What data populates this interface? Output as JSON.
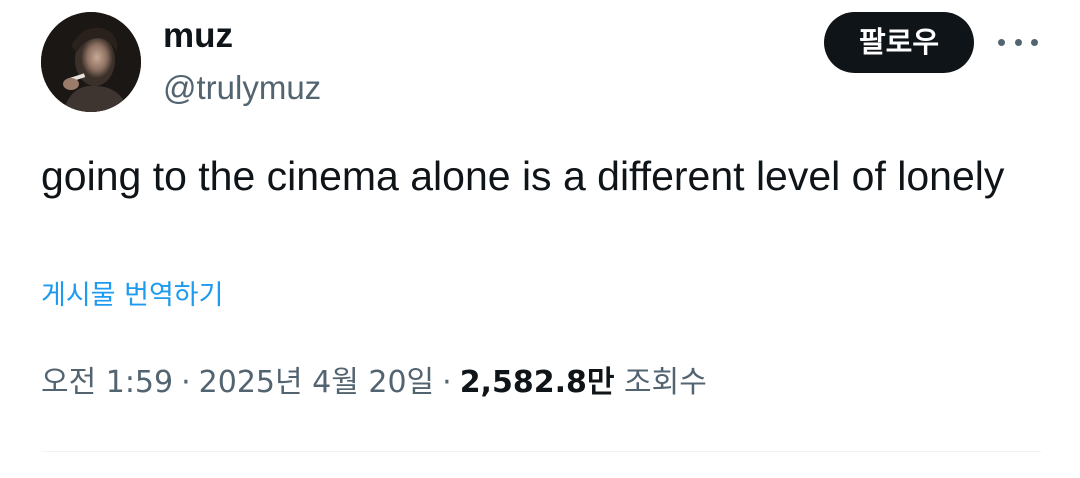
{
  "user": {
    "display_name": "muz",
    "handle": "@trulymuz",
    "avatar_icon": "profile-photo"
  },
  "actions": {
    "follow_label": "팔로우",
    "more_icon": "more-horizontal-icon"
  },
  "tweet": {
    "text": "going to the cinema alone is a different level of lonely",
    "translate_label": "게시물 번역하기"
  },
  "meta": {
    "time": "오전 1:59",
    "separator": "·",
    "date": "2025년 4월 20일",
    "views_count": "2,582.8만",
    "views_label": "조회수"
  },
  "colors": {
    "text_primary": "#0f1419",
    "text_secondary": "#536471",
    "link": "#1d9bf0",
    "button_bg": "#0f1419",
    "divider": "#eff3f4"
  }
}
